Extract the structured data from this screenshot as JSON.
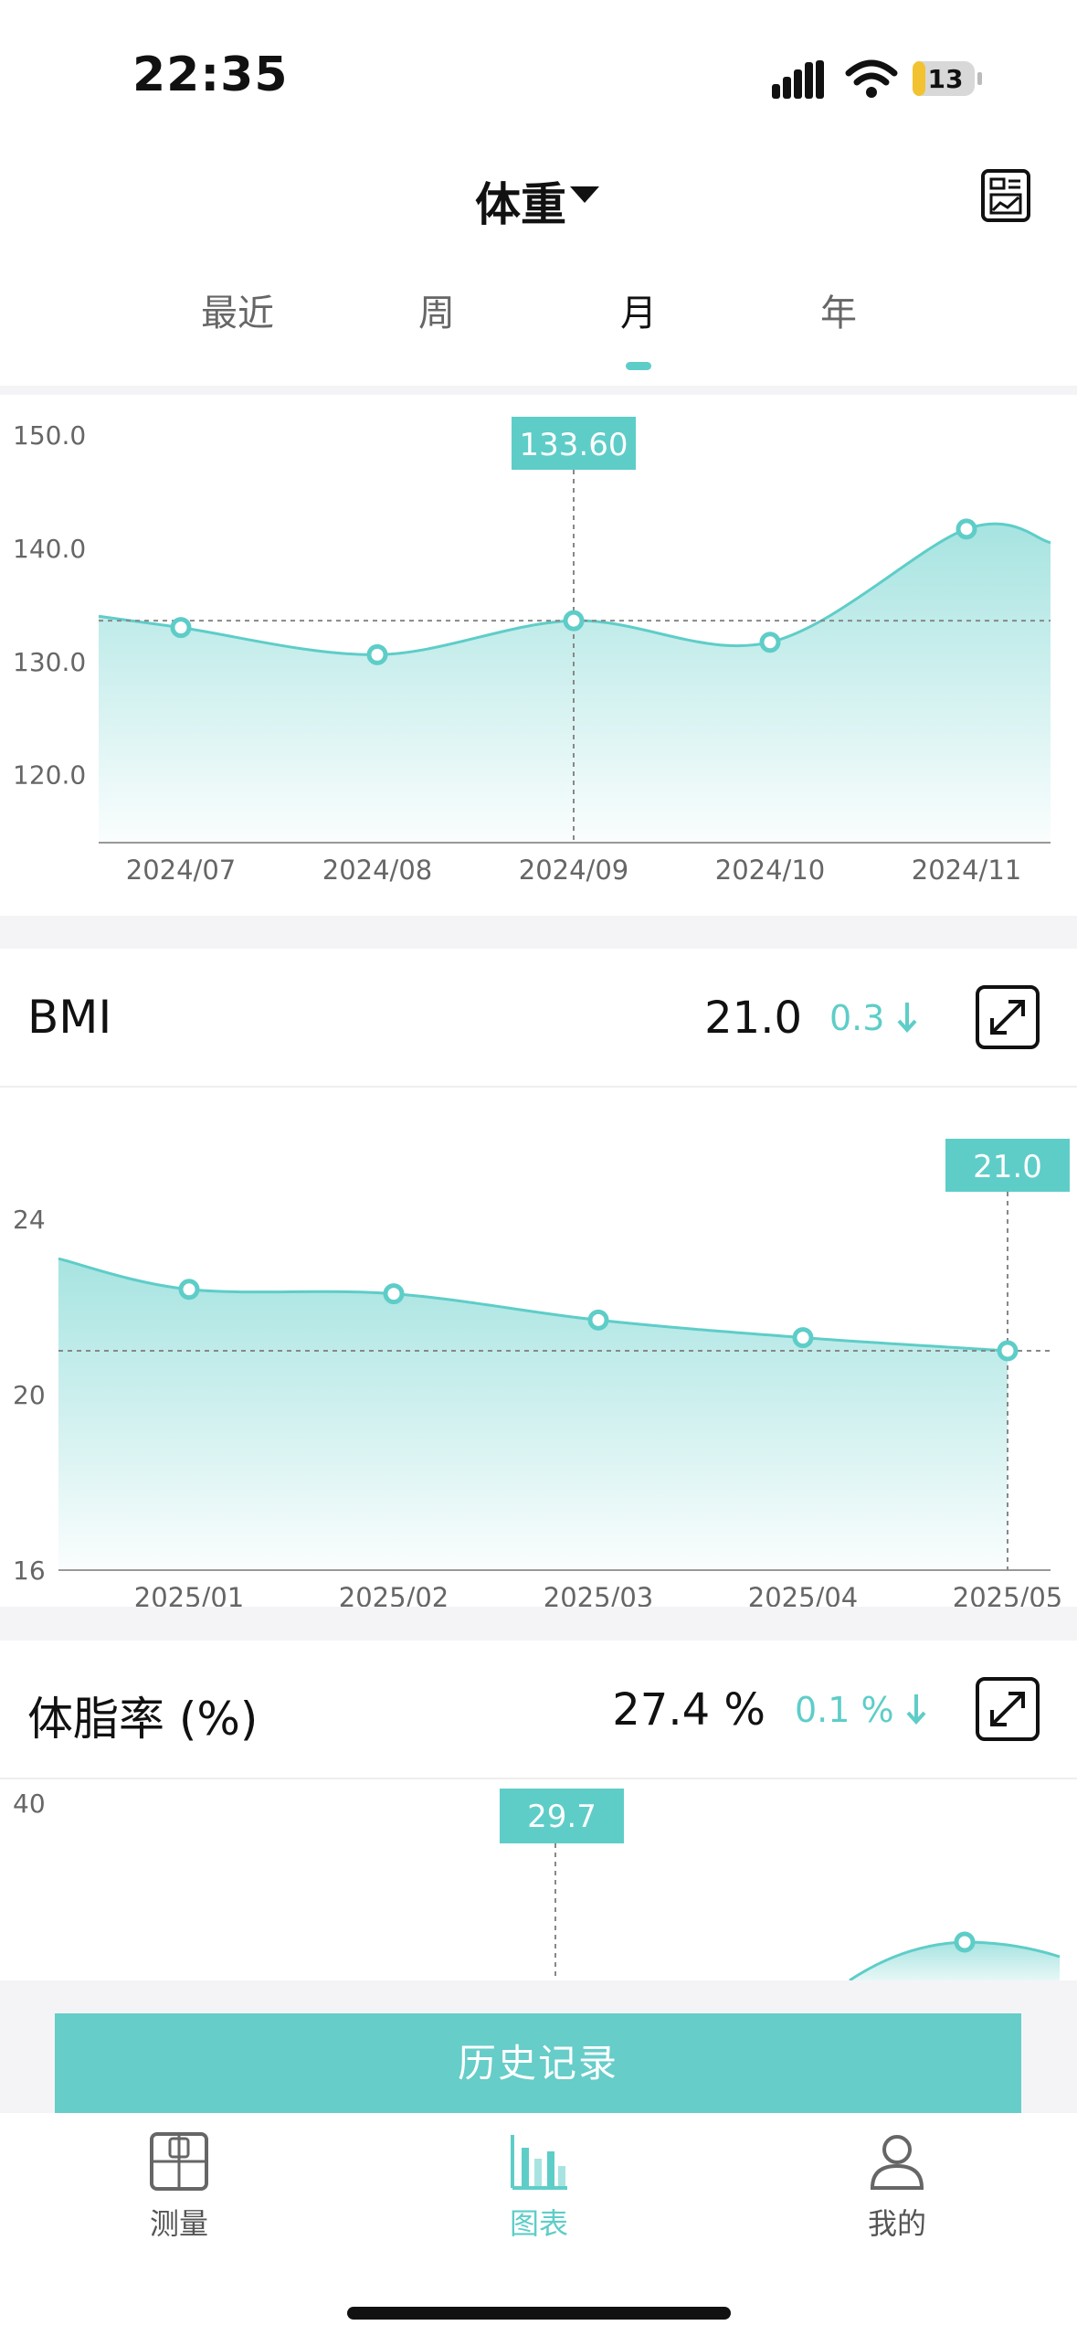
{
  "status_bar": {
    "time": "22:35",
    "battery": "13"
  },
  "header": {
    "title": "体重",
    "tabs": [
      {
        "label": "最近",
        "active": false
      },
      {
        "label": "周",
        "active": false
      },
      {
        "label": "月",
        "active": true
      },
      {
        "label": "年",
        "active": false
      }
    ]
  },
  "weight_chart": {
    "tooltip": "133.60",
    "chart_data": {
      "type": "area",
      "categories": [
        "2024/07",
        "2024/08",
        "2024/09",
        "2024/10",
        "2024/11"
      ],
      "values": [
        133.0,
        130.6,
        133.6,
        131.7,
        141.7
      ],
      "y_ticks": [
        "150.0",
        "140.0",
        "130.0",
        "120.0"
      ],
      "ylim": [
        114,
        150
      ],
      "selected_index": 2
    }
  },
  "bmi_card": {
    "title": "BMI",
    "value": "21.0",
    "delta": "0.3",
    "tooltip": "21.0",
    "chart_data": {
      "type": "area",
      "categories": [
        "2025/01",
        "2025/02",
        "2025/03",
        "2025/04",
        "2025/05"
      ],
      "values": [
        22.4,
        22.3,
        21.7,
        21.3,
        21.0
      ],
      "y_ticks": [
        "24",
        "20",
        "16"
      ],
      "ylim": [
        16,
        24
      ],
      "selected_index": 4
    }
  },
  "fat_card": {
    "title": "体脂率 (%)",
    "value": "27.4 %",
    "delta": "0.1 %",
    "tooltip": "29.7",
    "y_tick": "40"
  },
  "history_button": "历史记录",
  "tabbar": [
    {
      "label": "测量",
      "icon": "scale-icon",
      "active": false
    },
    {
      "label": "图表",
      "icon": "bar-chart-icon",
      "active": true
    },
    {
      "label": "我的",
      "icon": "user-icon",
      "active": false
    }
  ],
  "colors": {
    "accent": "#5ecdc8",
    "button": "#66cdc9"
  }
}
